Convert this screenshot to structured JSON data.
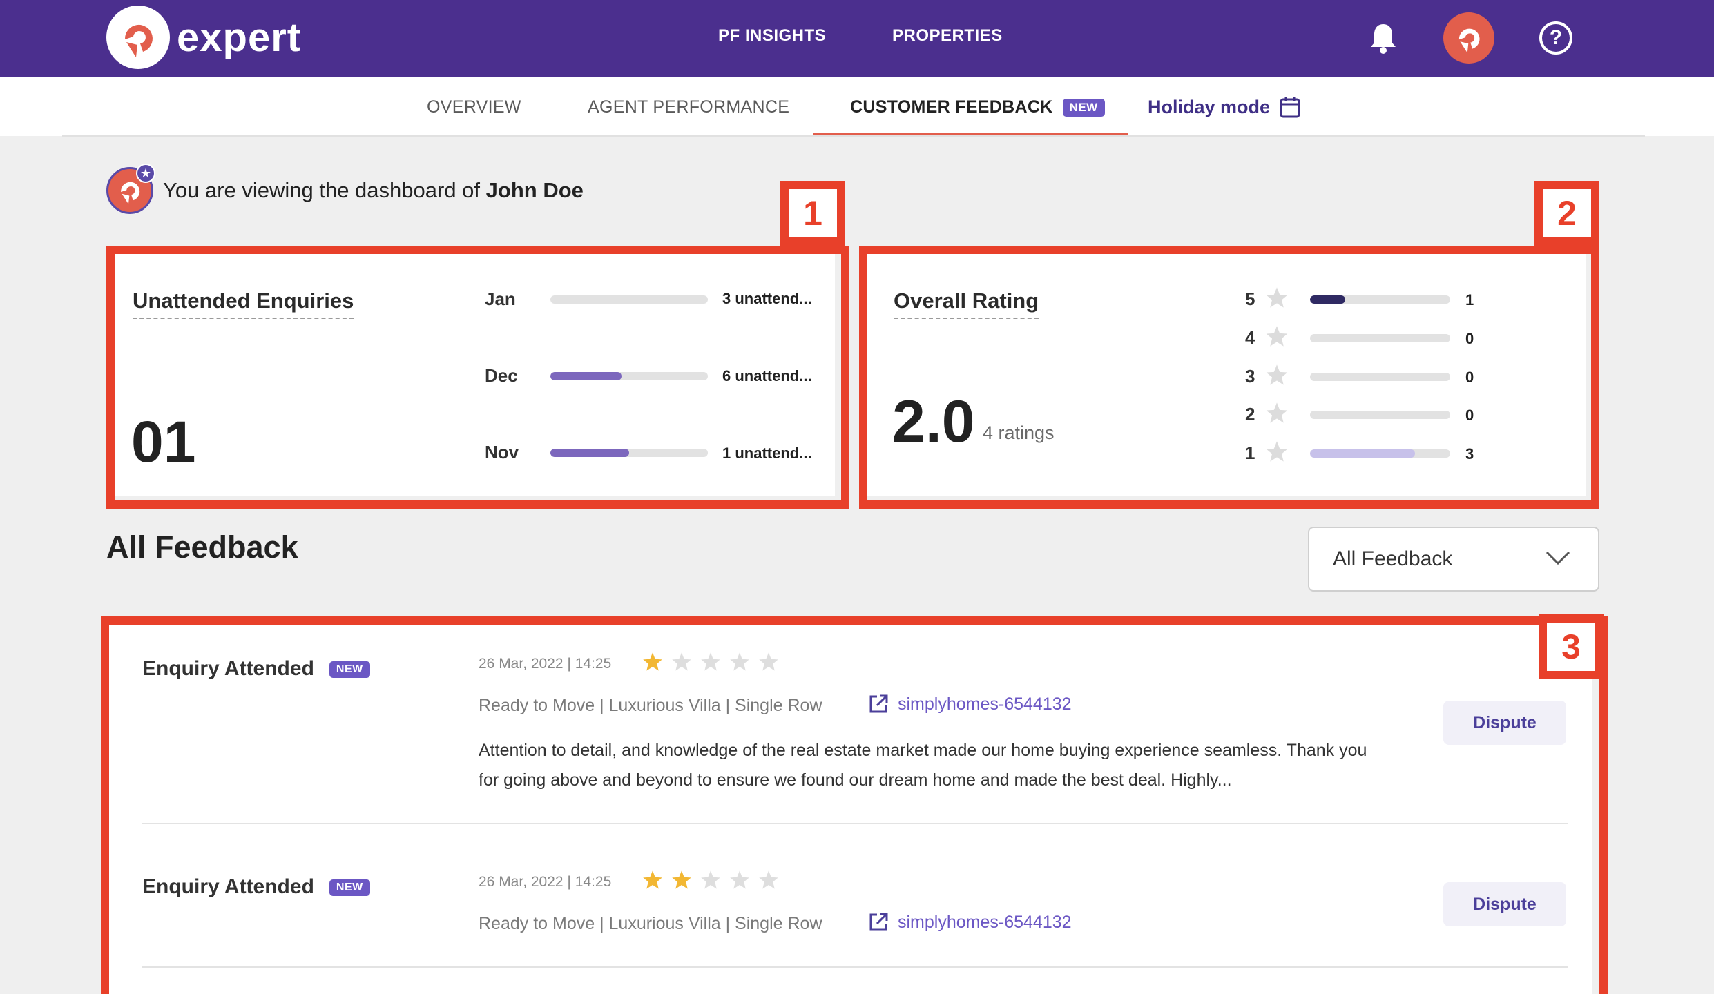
{
  "header": {
    "logo_text": "expert",
    "nav": [
      "PF INSIGHTS",
      "PROPERTIES"
    ],
    "help_symbol": "?"
  },
  "tabs": {
    "overview": "OVERVIEW",
    "agent_performance": "AGENT PERFORMANCE",
    "customer_feedback": "CUSTOMER FEEDBACK",
    "new_badge": "NEW",
    "holiday_mode": "Holiday mode"
  },
  "viewing": {
    "prefix": "You are viewing the dashboard of",
    "name": "John Doe"
  },
  "annotations": [
    "1",
    "2",
    "3"
  ],
  "unattended": {
    "title": "Unattended Enquiries",
    "total": "01",
    "months": [
      {
        "label": "Jan",
        "text": "3 unattend...",
        "fill": 0.0
      },
      {
        "label": "Dec",
        "text": "6 unattend...",
        "fill": 0.45
      },
      {
        "label": "Nov",
        "text": "1 unattend...",
        "fill": 0.5
      }
    ]
  },
  "rating": {
    "title": "Overall Rating",
    "value": "2.0",
    "count_text": "4 ratings",
    "rows": [
      {
        "star": "5",
        "count": "1",
        "fill": 0.25
      },
      {
        "star": "4",
        "count": "0",
        "fill": 0.0
      },
      {
        "star": "3",
        "count": "0",
        "fill": 0.0
      },
      {
        "star": "2",
        "count": "0",
        "fill": 0.0
      },
      {
        "star": "1",
        "count": "3",
        "fill": 0.75
      }
    ]
  },
  "feedback": {
    "section_title": "All Feedback",
    "filter_value": "All Feedback",
    "items": [
      {
        "title": "Enquiry Attended",
        "badge": "NEW",
        "date": "26 Mar, 2022 | 14:25",
        "stars": 1,
        "meta": "Ready to Move | Luxurious Villa | Single Row",
        "link": "simplyhomes-6544132",
        "text": "Attention to detail, and knowledge of the real estate market made our home buying experience seamless. Thank you for going above and beyond to ensure we found our dream home and made the best deal. Highly...",
        "dispute": "Dispute"
      },
      {
        "title": "Enquiry Attended",
        "badge": "NEW",
        "date": "26 Mar, 2022 | 14:25",
        "stars": 2,
        "meta": "Ready to Move | Luxurious Villa | Single Row",
        "link": "simplyhomes-6544132",
        "text": "",
        "dispute": "Dispute"
      }
    ]
  },
  "colors": {
    "brand_purple": "#4b2f8e",
    "accent_coral": "#e25e4c",
    "annotation_red": "#e8402a",
    "bar_purple": "#7c67bd",
    "bar_dark": "#2f2a63",
    "bar_light": "#c7c1ea",
    "star_gold": "#f2b733"
  }
}
